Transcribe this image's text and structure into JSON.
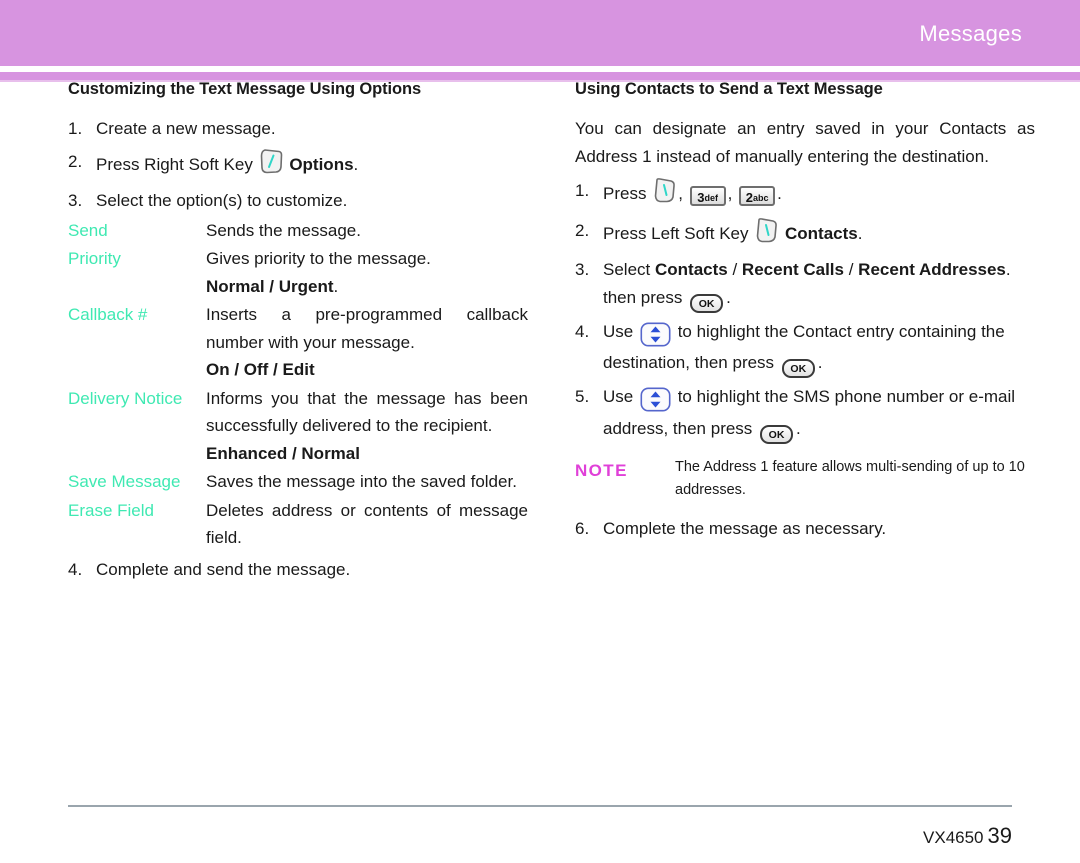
{
  "header": {
    "title": "Messages",
    "band_color": "#d794e0"
  },
  "left_column": {
    "section_title": "Customizing the Text Message Using Options",
    "steps": [
      {
        "num": "1.",
        "text": "Create a new message."
      },
      {
        "num": "2.",
        "pre": "Press Right Soft Key",
        "icon": "soft-key-icon",
        "post": "Options",
        "tail": "."
      },
      {
        "num": "3.",
        "text": "Select the option(s) to customize."
      }
    ],
    "options": [
      {
        "term": "Send",
        "definition": "Sends the message.",
        "values": ""
      },
      {
        "term": "Priority",
        "definition": "Gives priority to the message.",
        "values": "Normal / Urgent",
        "values_tail": "."
      },
      {
        "term": "Callback #",
        "definition": "Inserts a pre-programmed callback number with your message.",
        "values": "On / Off / Edit"
      },
      {
        "term": "Delivery Notice",
        "definition": "Informs you that the message has been successfully delivered to the recipient.",
        "values": "Enhanced / Normal"
      },
      {
        "term": "Save Message",
        "definition": "Saves the message into the saved folder.",
        "values": ""
      },
      {
        "term": "Erase Field",
        "definition": "Deletes address or contents of message field.",
        "values": ""
      }
    ],
    "final_step": {
      "num": "4.",
      "text": "Complete and send the message."
    }
  },
  "right_column": {
    "section_title": "Using Contacts to Send a Text Message",
    "intro": "You can designate an entry saved in your Contacts as Address 1 instead of manually entering the destination.",
    "step1": {
      "num": "1.",
      "label": "Press",
      "keys": [
        {
          "name": "soft-key-icon",
          "type": "soft"
        },
        {
          "name": "key-3-def",
          "type": "num",
          "digit": "3",
          "letters": "def"
        },
        {
          "name": "key-2-abc",
          "type": "num",
          "digit": "2",
          "letters": "abc"
        }
      ],
      "tail": "."
    },
    "step2": {
      "num": "2.",
      "pre": "Press Left Soft Key",
      "icon": "soft-key-icon",
      "post": "Contacts",
      "tail": "."
    },
    "step3": {
      "num": "3.",
      "pre": "Select",
      "opt1": "Contacts",
      "sep1": "/",
      "opt2": "Recent Calls",
      "sep2": "/",
      "opt3": "Recent Addresses",
      "mid": ". then press",
      "ok_label": "OK",
      "tail": "."
    },
    "step4": {
      "num": "4.",
      "pre": "Use",
      "nav_icon": "navigation-up-down-key-icon",
      "mid": "to highlight the Contact entry containing the destination, then press",
      "ok_label": "OK",
      "tail": "."
    },
    "step5": {
      "num": "5.",
      "pre": "Use",
      "nav_icon": "navigation-up-down-key-icon",
      "mid": "to highlight the SMS phone number or e-mail address, then press",
      "ok_label": "OK",
      "tail": "."
    },
    "note": {
      "label": "NOTE",
      "text": "The Address 1 feature allows multi-sending of up to 10 addresses."
    },
    "step6": {
      "num": "6.",
      "text": "Complete the message as necessary."
    }
  },
  "footer": {
    "model": "VX4650",
    "page_number": "39"
  },
  "colors": {
    "header_purple": "#d794e0",
    "option_term_teal": "#3fe9b2",
    "note_magenta": "#e040d8",
    "footer_rule": "#9aa5ad"
  }
}
